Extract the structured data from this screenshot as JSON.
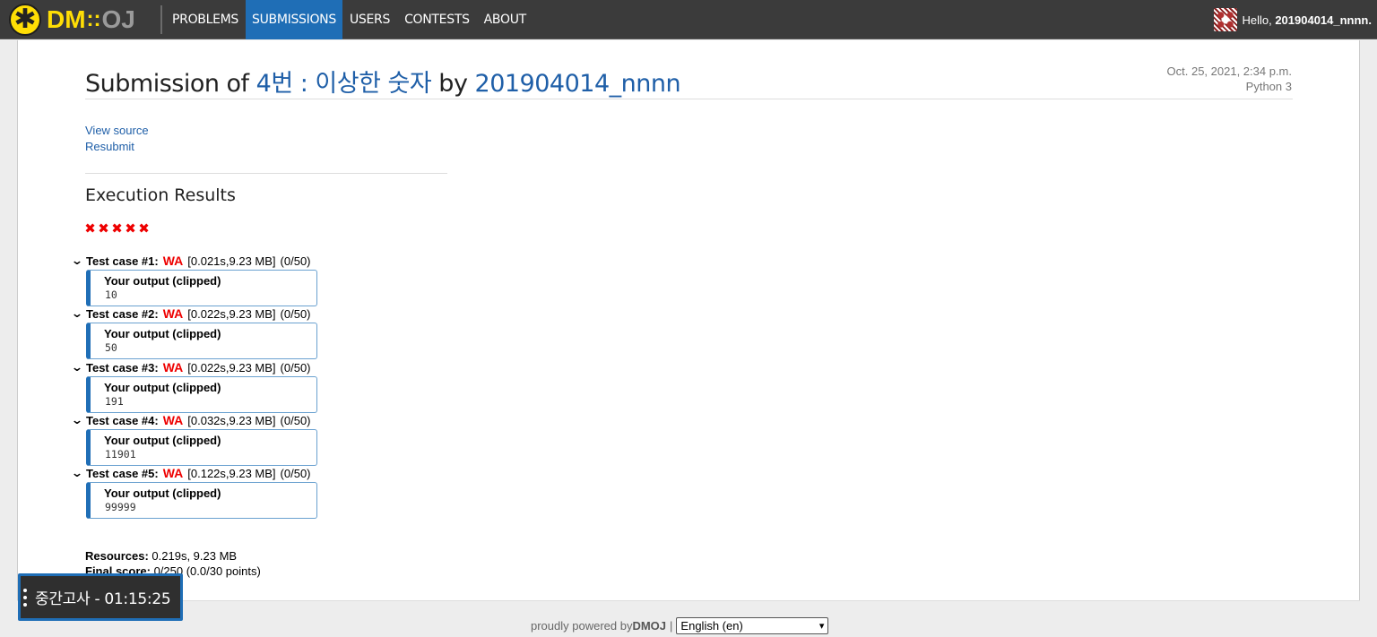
{
  "nav": {
    "logo_dm": "DM",
    "logo_sep": "::",
    "logo_oj": "OJ",
    "items": [
      {
        "label": "PROBLEMS"
      },
      {
        "label": "SUBMISSIONS"
      },
      {
        "label": "USERS"
      },
      {
        "label": "CONTESTS"
      },
      {
        "label": "ABOUT"
      }
    ],
    "active_item": "SUBMISSIONS",
    "greeting": "Hello, ",
    "username": "201904014_nnnn."
  },
  "submission": {
    "title_prefix": "Submission of ",
    "problem": "4번 : 이상한 숫자",
    "title_mid": " by ",
    "user": "201904014_nnnn",
    "date": "Oct. 25, 2021, 2:34 p.m.",
    "language": "Python 3",
    "view_source": "View source",
    "resubmit": "Resubmit"
  },
  "results": {
    "title": "Execution Results",
    "status_icons": [
      "✖",
      "✖",
      "✖",
      "✖",
      "✖"
    ],
    "output_label": "Your output (clipped)",
    "cases": [
      {
        "label": "Test case #1:",
        "verdict": "WA",
        "stats": "[0.021s,9.23 MB]",
        "score": "(0/50)",
        "output": "10"
      },
      {
        "label": "Test case #2:",
        "verdict": "WA",
        "stats": "[0.022s,9.23 MB]",
        "score": "(0/50)",
        "output": "50"
      },
      {
        "label": "Test case #3:",
        "verdict": "WA",
        "stats": "[0.022s,9.23 MB]",
        "score": "(0/50)",
        "output": "191"
      },
      {
        "label": "Test case #4:",
        "verdict": "WA",
        "stats": "[0.032s,9.23 MB]",
        "score": "(0/50)",
        "output": "11901"
      },
      {
        "label": "Test case #5:",
        "verdict": "WA",
        "stats": "[0.122s,9.23 MB]",
        "score": "(0/50)",
        "output": "99999"
      }
    ],
    "resources_label": "Resources:",
    "resources_value": " 0.219s, 9.23 MB",
    "final_label": "Final score:",
    "final_value": " 0/250 (0.0/30 points)"
  },
  "footer": {
    "powered": "proudly powered by ",
    "brand": "DMOJ",
    "pipe": "|",
    "language_selected": "English (en)"
  },
  "timer": {
    "text": "중간고사 - 01:15:25"
  },
  "colors": {
    "accent": "#1f6eb6",
    "logo_yellow": "#ffde05",
    "wa_red": "#ee0000",
    "nav_bg": "#3b3b3b"
  }
}
